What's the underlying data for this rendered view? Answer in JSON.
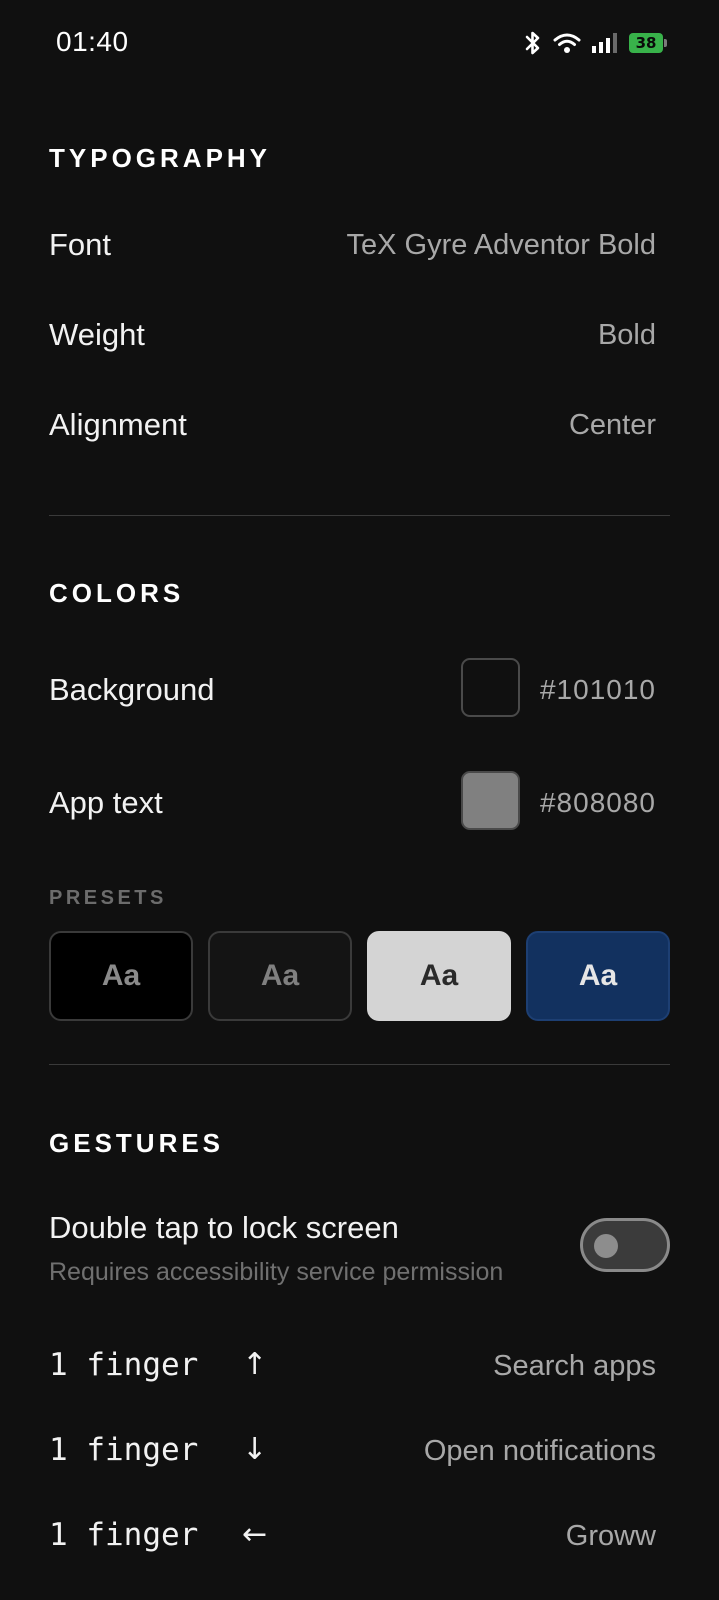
{
  "status_bar": {
    "time": "01:40",
    "battery": "38"
  },
  "typography": {
    "title": "TYPOGRAPHY",
    "rows": [
      {
        "label": "Font",
        "value": "TeX Gyre Adventor Bold"
      },
      {
        "label": "Weight",
        "value": "Bold"
      },
      {
        "label": "Alignment",
        "value": "Center"
      }
    ]
  },
  "colors": {
    "title": "COLORS",
    "rows": [
      {
        "label": "Background",
        "hex": "#101010",
        "swatch": "#101010"
      },
      {
        "label": "App text",
        "hex": "#808080",
        "swatch": "#808080"
      }
    ],
    "presets_label": "PRESETS",
    "presets": [
      {
        "label": "Aa",
        "bg": "#000000",
        "fg": "#8a8a8a",
        "border": "#3a3a3a"
      },
      {
        "label": "Aa",
        "bg": "#141414",
        "fg": "#808080",
        "border": "#3a3a3a"
      },
      {
        "label": "Aa",
        "bg": "#d4d4d4",
        "fg": "#2a2a2a",
        "border": "#d4d4d4"
      },
      {
        "label": "Aa",
        "bg": "#12315f",
        "fg": "#e6e6e6",
        "border": "#1d3f73"
      }
    ]
  },
  "gestures": {
    "title": "GESTURES",
    "double_tap": {
      "label": "Double tap to lock screen",
      "description": "Requires accessibility service permission",
      "enabled": false
    },
    "rows": [
      {
        "label": "1 finger",
        "arrow": "↑",
        "action": "Search apps"
      },
      {
        "label": "1 finger",
        "arrow": "↓",
        "action": "Open notifications"
      },
      {
        "label": "1 finger",
        "arrow": "←",
        "action": "Groww"
      }
    ]
  }
}
